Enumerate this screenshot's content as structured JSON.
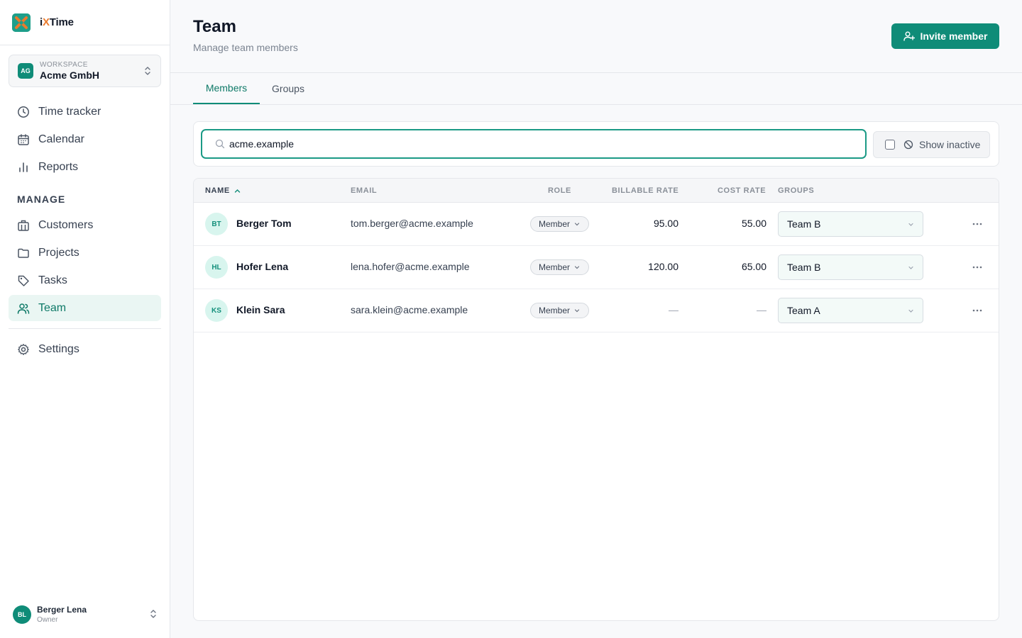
{
  "app": {
    "brand_prefix": "i",
    "brand_x": "X",
    "brand_suffix": "Time",
    "accent_color": "#0f8c78",
    "logo_orange": "#ea7a2c"
  },
  "workspace": {
    "label": "WORKSPACE",
    "name": "Acme GmbH",
    "initials": "AG"
  },
  "nav": {
    "time_tracker": "Time tracker",
    "calendar": "Calendar",
    "reports": "Reports",
    "section_manage": "MANAGE",
    "customers": "Customers",
    "projects": "Projects",
    "tasks": "Tasks",
    "team": "Team",
    "settings": "Settings"
  },
  "user": {
    "initials": "BL",
    "name": "Berger Lena",
    "role": "Owner"
  },
  "header": {
    "title": "Team",
    "subtitle": "Manage team members",
    "invite_label": "Invite member"
  },
  "tabs": {
    "members": "Members",
    "groups": "Groups"
  },
  "filter": {
    "search_value": "acme.example",
    "show_inactive_label": "Show inactive"
  },
  "table": {
    "headers": {
      "name": "NAME",
      "email": "EMAIL",
      "role": "ROLE",
      "billable_rate": "BILLABLE RATE",
      "cost_rate": "COST RATE",
      "groups": "GROUPS"
    },
    "rows": [
      {
        "initials": "BT",
        "name": "Berger Tom",
        "email": "tom.berger@acme.example",
        "role": "Member",
        "billable_rate": "95.00",
        "cost_rate": "55.00",
        "group": "Team B"
      },
      {
        "initials": "HL",
        "name": "Hofer Lena",
        "email": "lena.hofer@acme.example",
        "role": "Member",
        "billable_rate": "120.00",
        "cost_rate": "65.00",
        "group": "Team B"
      },
      {
        "initials": "KS",
        "name": "Klein Sara",
        "email": "sara.klein@acme.example",
        "role": "Member",
        "billable_rate": "—",
        "cost_rate": "—",
        "group": "Team A"
      }
    ]
  }
}
